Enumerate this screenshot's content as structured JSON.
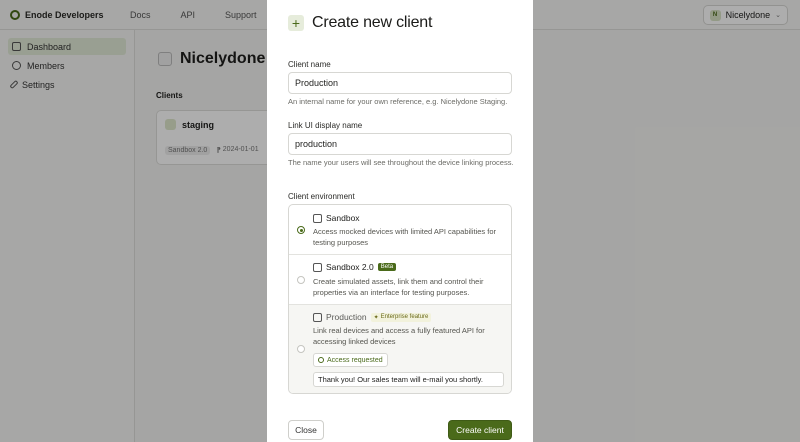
{
  "app": {
    "brand": "Enode Developers",
    "nav": [
      "Docs",
      "API",
      "Support"
    ],
    "account_initial": "N",
    "account_name": "Nicelydone",
    "sidebar": [
      {
        "label": "Dashboard",
        "icon": "dashboard-icon"
      },
      {
        "label": "Members",
        "icon": "members-icon"
      },
      {
        "label": "Settings",
        "icon": "wrench-icon"
      }
    ],
    "page_title": "Nicelydone",
    "clients_label": "Clients",
    "client": {
      "name": "staging",
      "tag": "Sandbox 2.0",
      "date": "2024-01-01"
    }
  },
  "modal": {
    "title": "Create new client",
    "client_name_label": "Client name",
    "client_name_value": "Production",
    "client_name_help": "An internal name for your own reference, e.g. Nicelydone Staging.",
    "link_label": "Link UI display name",
    "link_value": "production",
    "link_help": "The name your users will see throughout the device linking process.",
    "env_label": "Client environment",
    "options": [
      {
        "name": "Sandbox",
        "desc": "Access mocked devices with limited API capabilities for testing purposes"
      },
      {
        "name": "Sandbox 2.0",
        "badge": "Beta",
        "desc": "Create simulated assets, link them and control their properties via an interface for testing purposes."
      },
      {
        "name": "Production",
        "badge": "Enterprise feature",
        "desc": "Link real devices and access a fully featured API for accessing linked devices",
        "status": "Access requested",
        "message": "Thank you! Our sales team will e-mail you shortly."
      }
    ],
    "close_label": "Close",
    "create_label": "Create client"
  },
  "colors": {
    "accent": "#4a6a1a"
  }
}
